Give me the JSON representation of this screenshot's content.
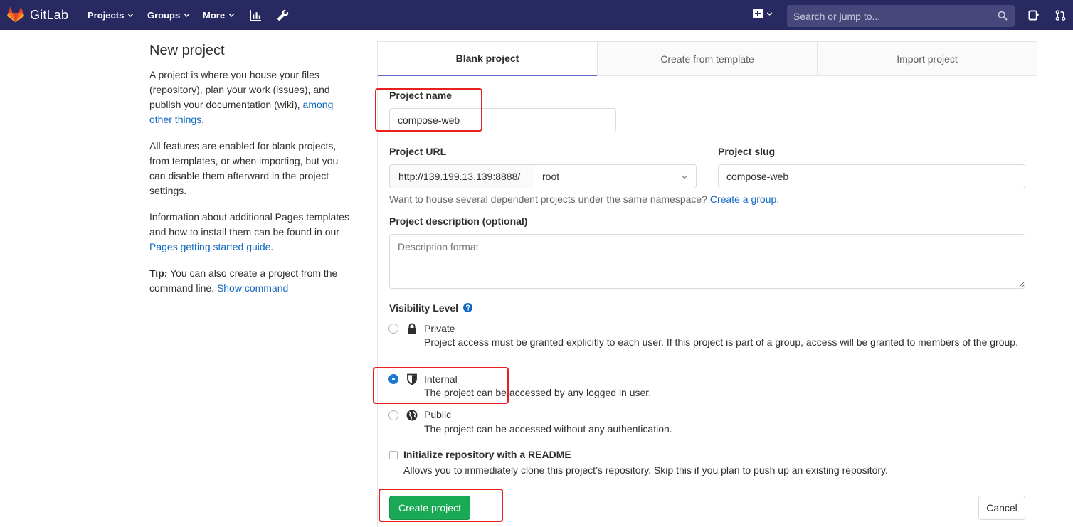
{
  "navbar": {
    "brand": "GitLab",
    "items": [
      {
        "label": "Projects"
      },
      {
        "label": "Groups"
      },
      {
        "label": "More"
      }
    ],
    "search_placeholder": "Search or jump to..."
  },
  "sidebar": {
    "title": "New project",
    "para1_text": "A project is where you house your files (repository), plan your work (issues), and publish your documentation (wiki), ",
    "para1_link": "among other things",
    "para1_end": ".",
    "para2": "All features are enabled for blank projects, from templates, or when importing, but you can disable them afterward in the project settings.",
    "para3_text": "Information about additional Pages templates and how to install them can be found in our ",
    "para3_link": "Pages getting started guide",
    "para3_end": ".",
    "tip_label": "Tip:",
    "tip_text": " You can also create a project from the command line. ",
    "tip_link": "Show command"
  },
  "tabs": [
    {
      "label": "Blank project",
      "active": true
    },
    {
      "label": "Create from template",
      "active": false
    },
    {
      "label": "Import project",
      "active": false
    }
  ],
  "form": {
    "project_name_label": "Project name",
    "project_name_value": "compose-web",
    "project_url_label": "Project URL",
    "project_url_prefix": "http://139.199.13.139:8888/",
    "namespace_value": "root",
    "project_slug_label": "Project slug",
    "project_slug_value": "compose-web",
    "namespace_help": "Want to house several dependent projects under the same namespace? ",
    "namespace_help_link": "Create a group.",
    "description_label": "Project description (optional)",
    "description_placeholder": "Description format",
    "visibility_label": "Visibility Level",
    "visibility": [
      {
        "title": "Private",
        "desc": "Project access must be granted explicitly to each user. If this project is part of a group, access will be granted to members of the group.",
        "checked": false,
        "icon": "lock-icon"
      },
      {
        "title": "Internal",
        "desc": "The project can be accessed by any logged in user.",
        "checked": true,
        "icon": "shield-icon"
      },
      {
        "title": "Public",
        "desc": "The project can be accessed without any authentication.",
        "checked": false,
        "icon": "globe-icon"
      }
    ],
    "readme_label": "Initialize repository with a README",
    "readme_desc": "Allows you to immediately clone this project’s repository. Skip this if you plan to push up an existing repository.",
    "create_button": "Create project",
    "cancel_button": "Cancel"
  },
  "colors": {
    "navbar": "#292961",
    "link": "#1068bf",
    "primary_button": "#1aaa55",
    "tab_active_underline": "#6666c4",
    "annotation": "#ea2020"
  }
}
